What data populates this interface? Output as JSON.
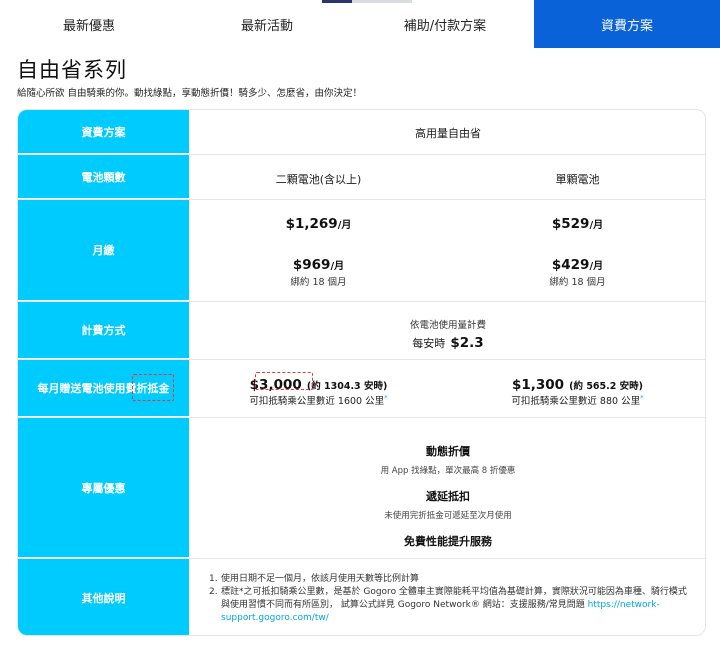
{
  "tabs": [
    {
      "label": "最新優惠",
      "active": false
    },
    {
      "label": "最新活動",
      "active": false
    },
    {
      "label": "補助/付款方案",
      "active": false
    },
    {
      "label": "資費方案",
      "active": true
    }
  ],
  "page": {
    "title": "自由省系列",
    "subtitle": "給隨心所欲 自由騎乘的你。動找綠點，享動態折價！騎多少、怎麼省，由你決定！"
  },
  "colors": {
    "accent_blue": "#0a62d8",
    "label_cyan": "#00cbff",
    "link": "#00a6e0",
    "highlight": "#e23b3b"
  },
  "table": {
    "plan": {
      "label": "資費方案",
      "value": "高用量自由省"
    },
    "battery": {
      "label": "電池顆數",
      "left": "二顆電池(含以上)",
      "right": "單顆電池"
    },
    "monthly": {
      "label": "月繳",
      "left_price": "$1,269",
      "right_price": "$529",
      "left_price2": "$969",
      "right_price2": "$429",
      "per_month": "/月",
      "contract": "綁約 18 個月"
    },
    "billing": {
      "label": "計費方式",
      "line1": "依電池使用量計費",
      "line2_prefix": "每安時",
      "line2_price": "$2.3"
    },
    "credit": {
      "label": "每月贈送電池使用費折抵金",
      "left_amount": "$3,000",
      "left_hours": "(約 1304.3 安時)",
      "left_desc": "可扣抵騎乘公里數近 1600 公里",
      "right_amount": "$1,300",
      "right_hours": "(約 565.2 安時)",
      "right_desc": "可扣抵騎乘公里數近 880 公里",
      "footnote_mark": "*"
    },
    "perks": {
      "label": "專屬優惠",
      "items": [
        {
          "title": "動態折價",
          "desc": "用 App 找綠點，單次最高 8 折優惠"
        },
        {
          "title": "遞延抵扣",
          "desc": "未使用完折抵金可遞延至次月使用"
        },
        {
          "title": "免費性能提升服務",
          "desc": ""
        }
      ]
    },
    "notes": {
      "label": "其他說明",
      "item1": "使用日期不足一個月，依該月使用天數等比例計算",
      "item2_text": "標註*之可抵扣騎乘公里數，是基於 Gogoro 全體車主實際能耗平均值為基礎計算，實際狀況可能因為車種、騎行模式與使用習慣不同而有所區別， 試算公式詳見 Gogoro Network® 網站：支援服務/常見問題",
      "item2_link": "https://network-support.gogoro.com/tw/"
    }
  }
}
